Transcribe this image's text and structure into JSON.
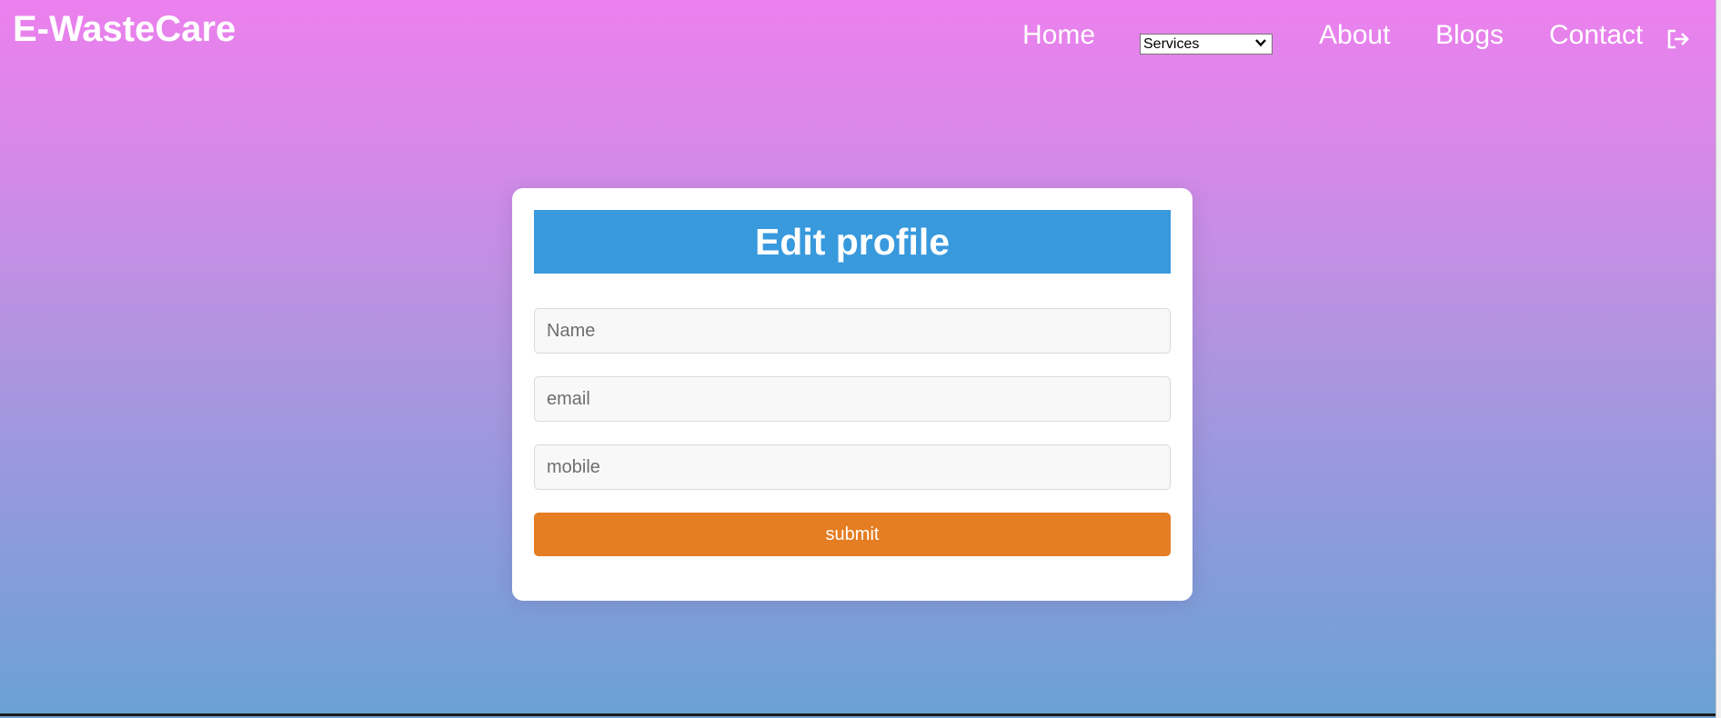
{
  "header": {
    "logo": "E-WasteCare",
    "nav": {
      "home": "Home",
      "services": "Services",
      "about": "About",
      "blogs": "Blogs",
      "contact": "Contact"
    },
    "logout_icon": "logout-icon"
  },
  "form": {
    "title": "Edit profile",
    "name_placeholder": "Name",
    "email_placeholder": "email",
    "mobile_placeholder": "mobile",
    "submit_label": "submit"
  },
  "colors": {
    "gradient_top": "#ec80ee",
    "gradient_bottom": "#6ba2d3",
    "title_bar": "#3899dd",
    "submit_button": "#e57d22"
  }
}
